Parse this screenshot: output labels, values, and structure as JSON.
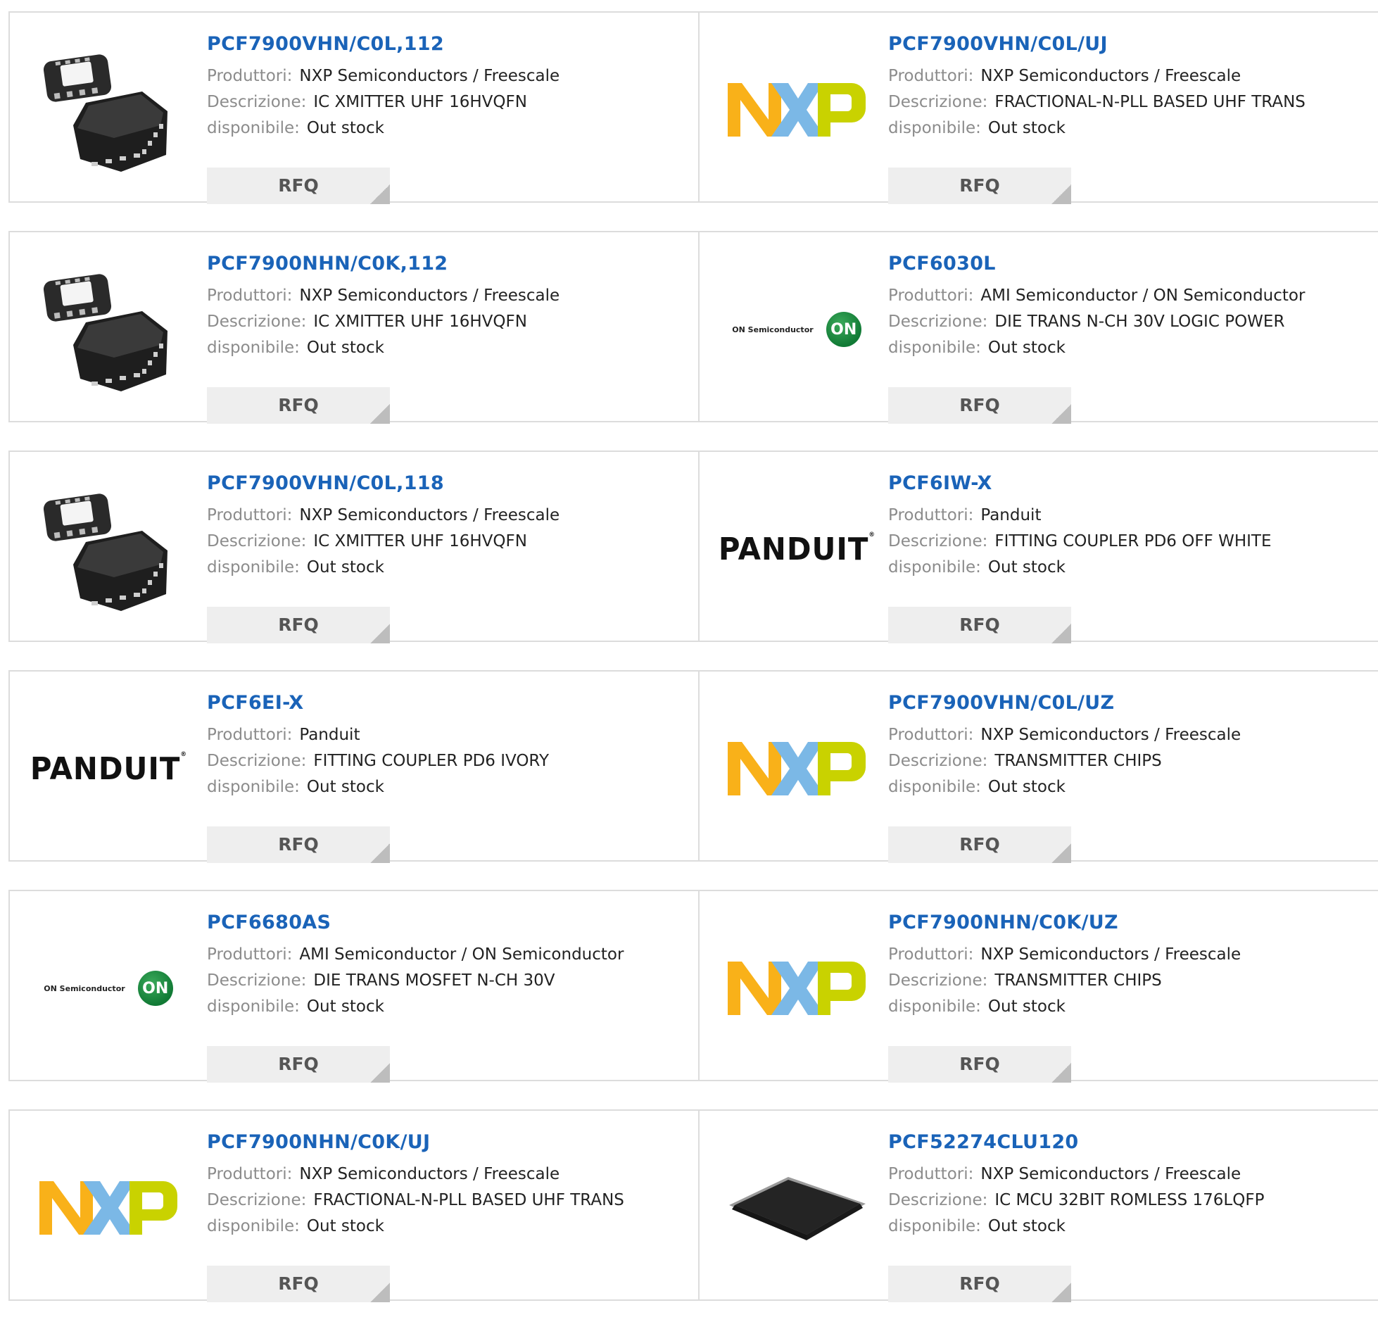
{
  "labels": {
    "manufacturer": "Produttori:",
    "description": "Descrizione:",
    "availability": "disponibile:",
    "rfq": "RFQ"
  },
  "rows": [
    [
      {
        "part": "PCF7900VHN/C0L,112",
        "manufacturer": "NXP Semiconductors / Freescale",
        "description": "IC XMITTER UHF 16HVQFN",
        "availability": "Out stock",
        "image": "qfn-chip"
      },
      {
        "part": "PCF7900VHN/C0L/UJ",
        "manufacturer": "NXP Semiconductors / Freescale",
        "description": "FRACTIONAL-N-PLL BASED UHF TRANS",
        "availability": "Out stock",
        "image": "nxp-logo"
      }
    ],
    [
      {
        "part": "PCF7900NHN/C0K,112",
        "manufacturer": "NXP Semiconductors / Freescale",
        "description": "IC XMITTER UHF 16HVQFN",
        "availability": "Out stock",
        "image": "qfn-chip"
      },
      {
        "part": "PCF6030L",
        "manufacturer": "AMI Semiconductor / ON Semiconductor",
        "description": "DIE TRANS N-CH 30V LOGIC POWER",
        "availability": "Out stock",
        "image": "onsemi-logo"
      }
    ],
    [
      {
        "part": "PCF7900VHN/C0L,118",
        "manufacturer": "NXP Semiconductors / Freescale",
        "description": "IC XMITTER UHF 16HVQFN",
        "availability": "Out stock",
        "image": "qfn-chip"
      },
      {
        "part": "PCF6IW-X",
        "manufacturer": "Panduit",
        "description": "FITTING COUPLER PD6 OFF WHITE",
        "availability": "Out stock",
        "image": "panduit-logo"
      }
    ],
    [
      {
        "part": "PCF6EI-X",
        "manufacturer": "Panduit",
        "description": "FITTING COUPLER PD6 IVORY",
        "availability": "Out stock",
        "image": "panduit-logo"
      },
      {
        "part": "PCF7900VHN/C0L/UZ",
        "manufacturer": "NXP Semiconductors / Freescale",
        "description": "TRANSMITTER CHIPS",
        "availability": "Out stock",
        "image": "nxp-logo"
      }
    ],
    [
      {
        "part": "PCF6680AS",
        "manufacturer": "AMI Semiconductor / ON Semiconductor",
        "description": "DIE TRANS MOSFET N-CH 30V",
        "availability": "Out stock",
        "image": "onsemi-logo"
      },
      {
        "part": "PCF7900NHN/C0K/UZ",
        "manufacturer": "NXP Semiconductors / Freescale",
        "description": "TRANSMITTER CHIPS",
        "availability": "Out stock",
        "image": "nxp-logo"
      }
    ],
    [
      {
        "part": "PCF7900NHN/C0K/UJ",
        "manufacturer": "NXP Semiconductors / Freescale",
        "description": "FRACTIONAL-N-PLL BASED UHF TRANS",
        "availability": "Out stock",
        "image": "nxp-logo"
      },
      {
        "part": "PCF52274CLU120",
        "manufacturer": "NXP Semiconductors / Freescale",
        "description": "IC MCU 32BIT ROMLESS 176LQFP",
        "availability": "Out stock",
        "image": "lqfp-chip"
      }
    ]
  ],
  "logos": {
    "panduit": "PANDUIT",
    "onsemi": "ON Semiconductor",
    "onsemi_mark": "ON"
  },
  "colors": {
    "part_link": "#1a63b8",
    "label": "#8c8c8c",
    "value": "#222222",
    "rfq_bg": "#eeeeee",
    "border": "#dcdcdc",
    "nxp_orange": "#f9b119",
    "nxp_blue": "#7bb8e6",
    "nxp_green": "#c9d200",
    "onsemi_green": "#117a35"
  }
}
